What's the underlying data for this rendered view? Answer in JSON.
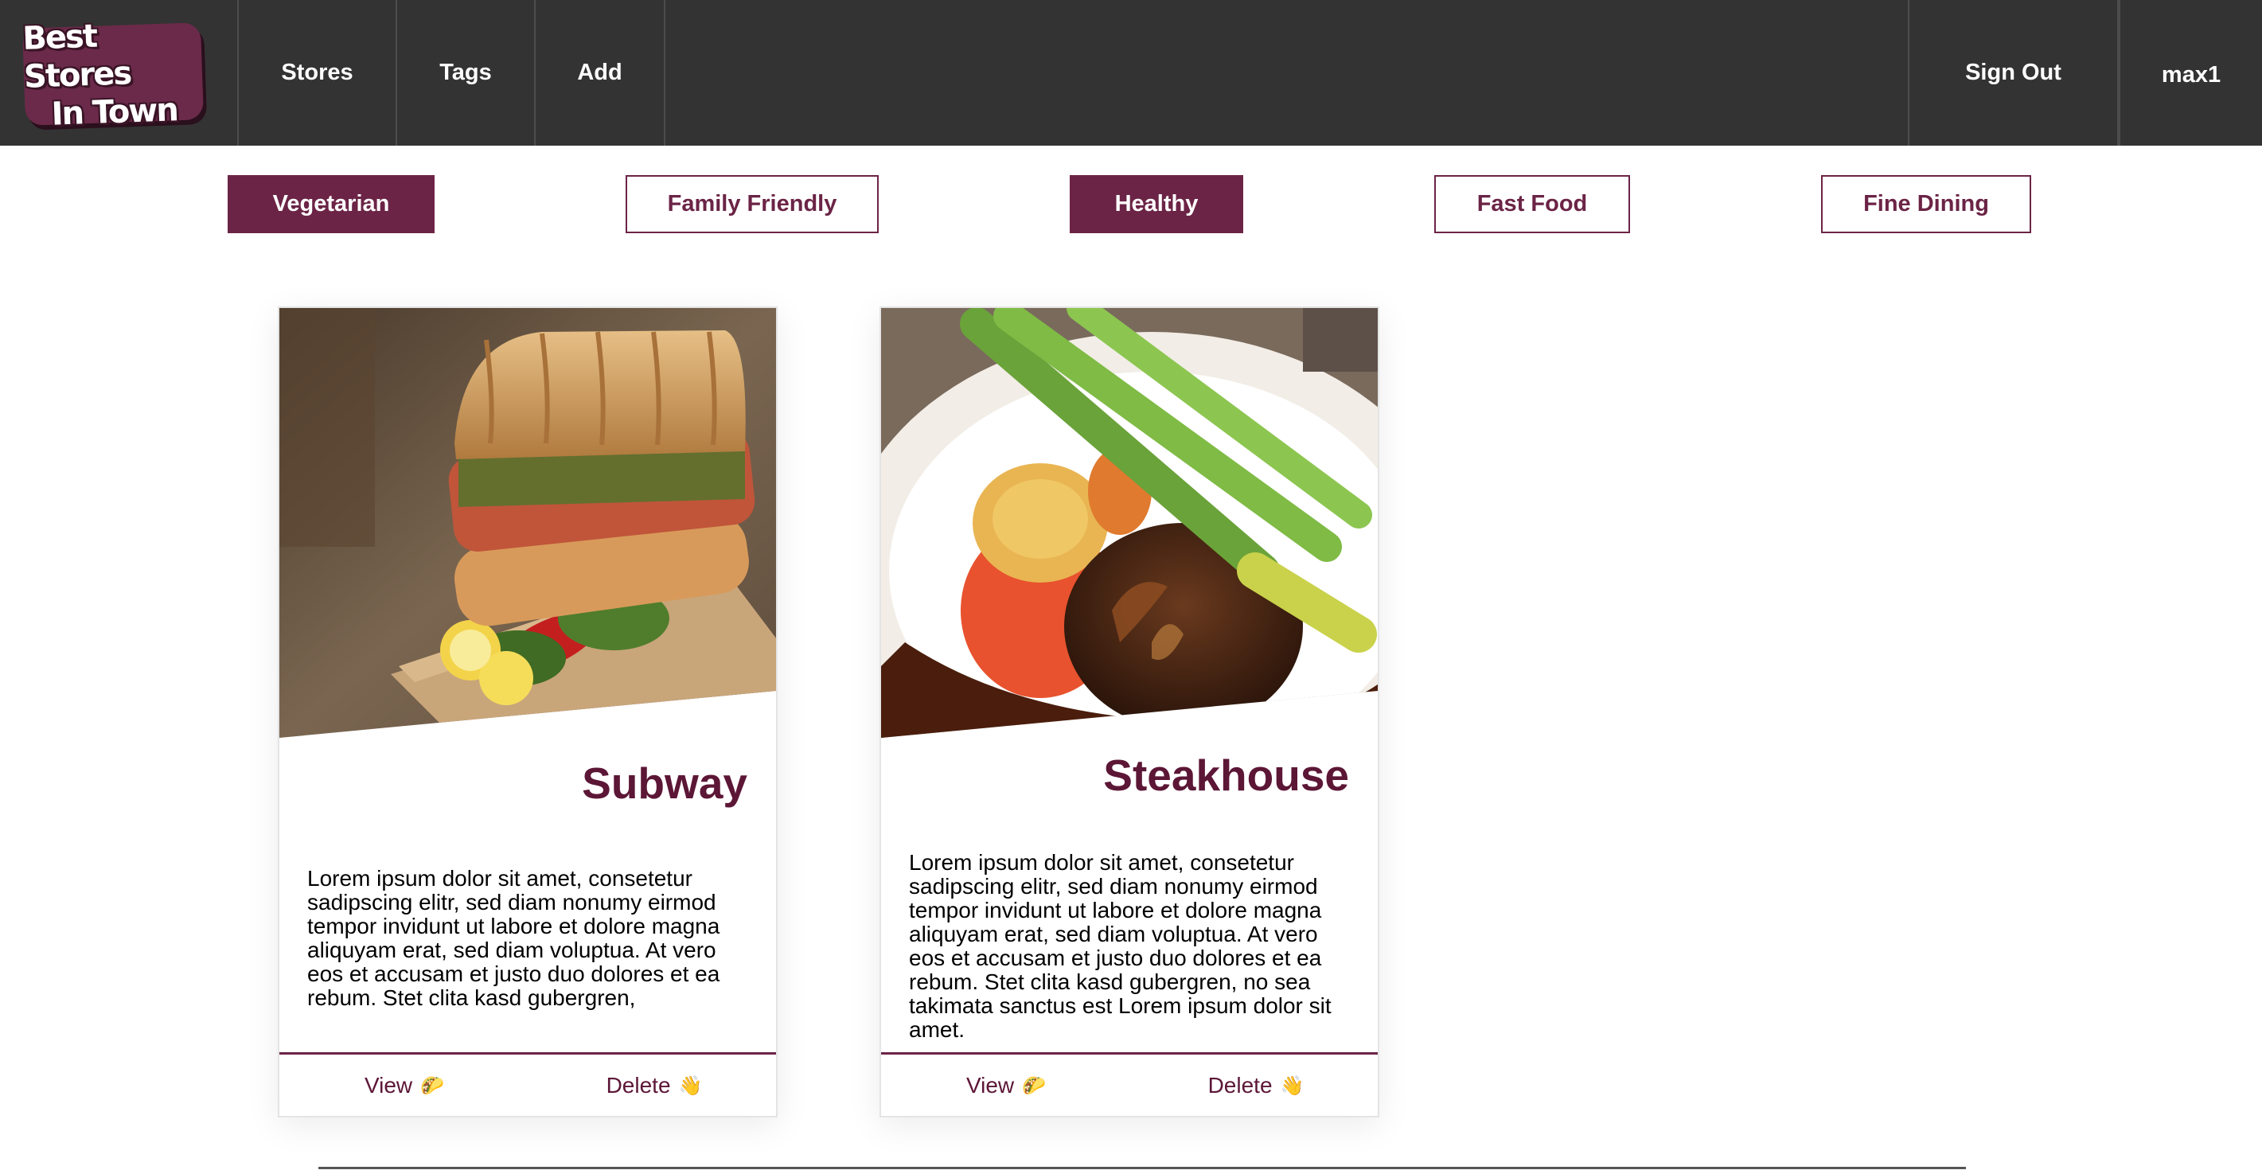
{
  "logo": {
    "line1": "Best Stores",
    "line2": "In Town"
  },
  "nav": {
    "stores": "Stores",
    "tags": "Tags",
    "add": "Add",
    "sign_out": "Sign Out",
    "user": "max1"
  },
  "tags": [
    {
      "label": "Vegetarian",
      "active": true
    },
    {
      "label": "Family Friendly",
      "active": false
    },
    {
      "label": "Healthy",
      "active": true
    },
    {
      "label": "Fast Food",
      "active": false
    },
    {
      "label": "Fine Dining",
      "active": false
    }
  ],
  "stores": [
    {
      "name": "Subway",
      "description": "Lorem ipsum dolor sit amet, consetetur sadipscing elitr, sed diam nonumy eirmod tempor invidunt ut labore et dolore magna aliquyam erat, sed diam voluptua. At vero eos et accusam et justo duo dolores et ea rebum. Stet clita kasd gubergren,",
      "view_label": "View",
      "view_emoji": "🌮",
      "delete_label": "Delete",
      "delete_emoji": "👋"
    },
    {
      "name": "Steakhouse",
      "description": "Lorem ipsum dolor sit amet, consetetur sadipscing elitr, sed diam nonumy eirmod tempor invidunt ut labore et dolore magna aliquyam erat, sed diam voluptua. At vero eos et accusam et justo duo dolores et ea rebum. Stet clita kasd gubergren, no sea takimata sanctus est Lorem ipsum dolor sit amet.",
      "view_label": "View",
      "view_emoji": "🌮",
      "delete_label": "Delete",
      "delete_emoji": "👋"
    }
  ],
  "colors": {
    "header_bg": "#333333",
    "accent": "#6b2446",
    "title": "#5c1636"
  }
}
